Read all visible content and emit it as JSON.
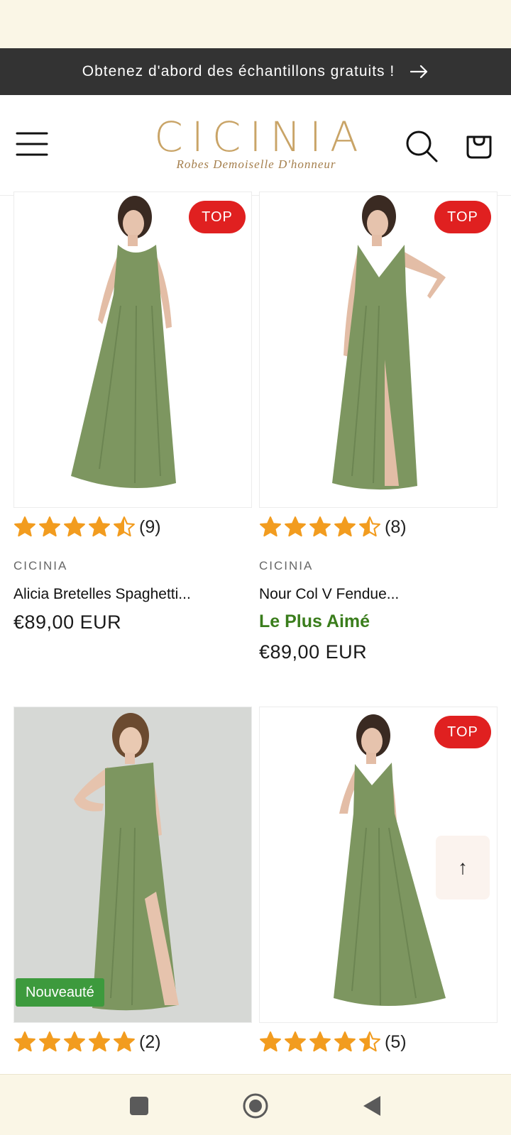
{
  "announcement": {
    "text": "Obtenez d'abord des échantillons gratuits !"
  },
  "header": {
    "logo_name": "CICINIA",
    "logo_tagline": "Robes Demoiselle D'honneur"
  },
  "products": [
    {
      "badge": "TOP",
      "rating": 4.5,
      "review_count": "(9)",
      "brand": "CICINIA",
      "title": "Alicia Bretelles Spaghetti...",
      "promo": "",
      "price": "€89,00 EUR"
    },
    {
      "badge": "TOP",
      "rating": 4.5,
      "review_count": "(8)",
      "brand": "CICINIA",
      "title": "Nour Col V Fendue...",
      "promo": "Le Plus Aimé",
      "price": "€89,00 EUR"
    },
    {
      "badge": "Nouveauté",
      "rating": 5,
      "review_count": "(2)"
    },
    {
      "badge": "TOP",
      "rating": 4.5,
      "review_count": "(5)"
    }
  ],
  "scroll_top": {
    "label": "↑"
  },
  "colors": {
    "accent_gold": "#c9a467",
    "star": "#f29c1f",
    "badge_red": "#e02020",
    "badge_green": "#3d9a3d",
    "promo_green": "#3a7d1c",
    "dress_green": "#7d9660"
  }
}
